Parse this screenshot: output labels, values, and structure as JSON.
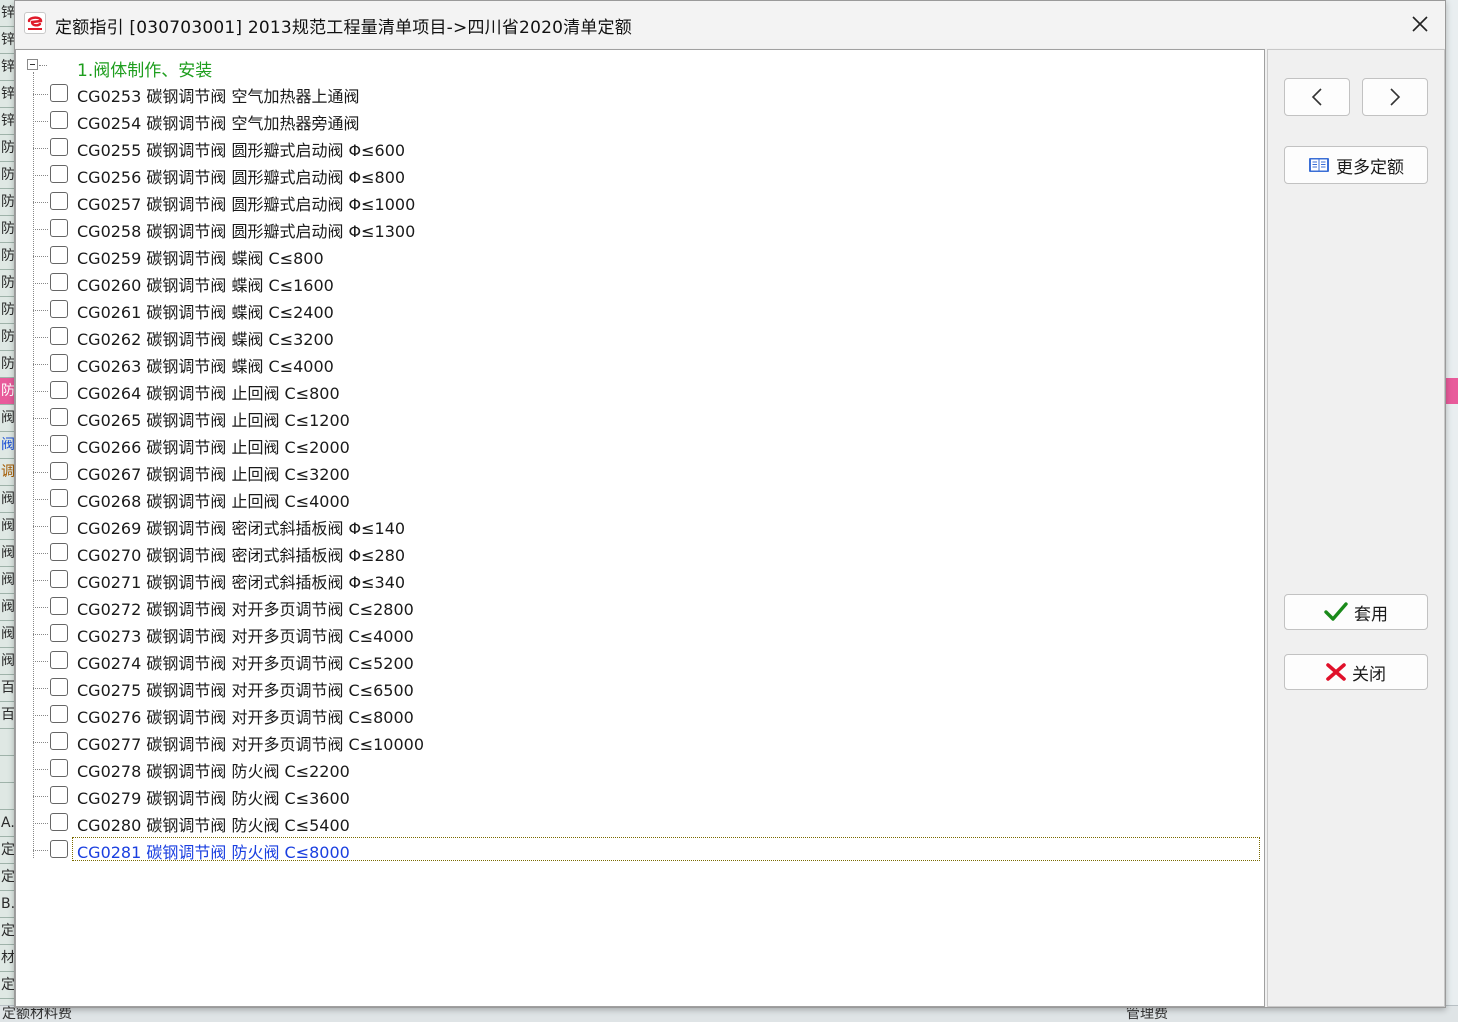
{
  "window": {
    "title": "定额指引 [030703001] 2013规范工程量清单项目->四川省2020清单定额"
  },
  "background": {
    "left_column": [
      "锌",
      "锌",
      "锌",
      "锌",
      "锌",
      "防",
      "防",
      "防",
      "防",
      "防",
      "防",
      "防",
      "防",
      "防",
      "防",
      "阀",
      "阀",
      "调",
      "阀",
      "阀",
      "阀",
      "阀",
      "阀",
      "阀",
      "阀",
      "百",
      "百",
      "",
      "",
      "",
      "A.",
      "定",
      "定",
      "B.",
      "定",
      "材",
      "定"
    ],
    "bottom_left": "定额材料费",
    "bottom_right": "管理费"
  },
  "tree": {
    "root_label": "1.阀体制作、安装",
    "items": [
      {
        "label": "CG0253 碳钢调节阀 空气加热器上通阀"
      },
      {
        "label": "CG0254 碳钢调节阀 空气加热器旁通阀"
      },
      {
        "label": "CG0255 碳钢调节阀 圆形瓣式启动阀 Φ≤600"
      },
      {
        "label": "CG0256 碳钢调节阀 圆形瓣式启动阀 Φ≤800"
      },
      {
        "label": "CG0257 碳钢调节阀 圆形瓣式启动阀 Φ≤1000"
      },
      {
        "label": "CG0258 碳钢调节阀 圆形瓣式启动阀 Φ≤1300"
      },
      {
        "label": "CG0259 碳钢调节阀 蝶阀 C≤800"
      },
      {
        "label": "CG0260 碳钢调节阀 蝶阀 C≤1600"
      },
      {
        "label": "CG0261 碳钢调节阀 蝶阀 C≤2400"
      },
      {
        "label": "CG0262 碳钢调节阀 蝶阀 C≤3200"
      },
      {
        "label": "CG0263 碳钢调节阀 蝶阀 C≤4000"
      },
      {
        "label": "CG0264 碳钢调节阀 止回阀 C≤800"
      },
      {
        "label": "CG0265 碳钢调节阀 止回阀 C≤1200"
      },
      {
        "label": "CG0266 碳钢调节阀 止回阀 C≤2000"
      },
      {
        "label": "CG0267 碳钢调节阀 止回阀 C≤3200"
      },
      {
        "label": "CG0268 碳钢调节阀 止回阀 C≤4000"
      },
      {
        "label": "CG0269 碳钢调节阀 密闭式斜插板阀 Φ≤140"
      },
      {
        "label": "CG0270 碳钢调节阀 密闭式斜插板阀 Φ≤280"
      },
      {
        "label": "CG0271 碳钢调节阀 密闭式斜插板阀 Φ≤340"
      },
      {
        "label": "CG0272 碳钢调节阀 对开多页调节阀 C≤2800"
      },
      {
        "label": "CG0273 碳钢调节阀 对开多页调节阀 C≤4000"
      },
      {
        "label": "CG0274 碳钢调节阀 对开多页调节阀 C≤5200"
      },
      {
        "label": "CG0275 碳钢调节阀 对开多页调节阀 C≤6500"
      },
      {
        "label": "CG0276 碳钢调节阀 对开多页调节阀 C≤8000"
      },
      {
        "label": "CG0277 碳钢调节阀 对开多页调节阀 C≤10000"
      },
      {
        "label": "CG0278 碳钢调节阀 防火阀 C≤2200"
      },
      {
        "label": "CG0279 碳钢调节阀 防火阀 C≤3600"
      },
      {
        "label": "CG0280 碳钢调节阀 防火阀 C≤5400"
      },
      {
        "label": "CG0281 碳钢调节阀 防火阀 C≤8000",
        "selected": true
      }
    ]
  },
  "side": {
    "prev_glyph": "<",
    "next_glyph": ">",
    "more_label": "更多定额",
    "apply_label": "套用",
    "close_label": "关闭"
  },
  "colors": {
    "root_green": "#1e9e1e",
    "selected_blue": "#1a3fe0",
    "check_green": "#1a8a1a",
    "close_red": "#e0102a",
    "highlight_pink": "#e85b9b"
  }
}
